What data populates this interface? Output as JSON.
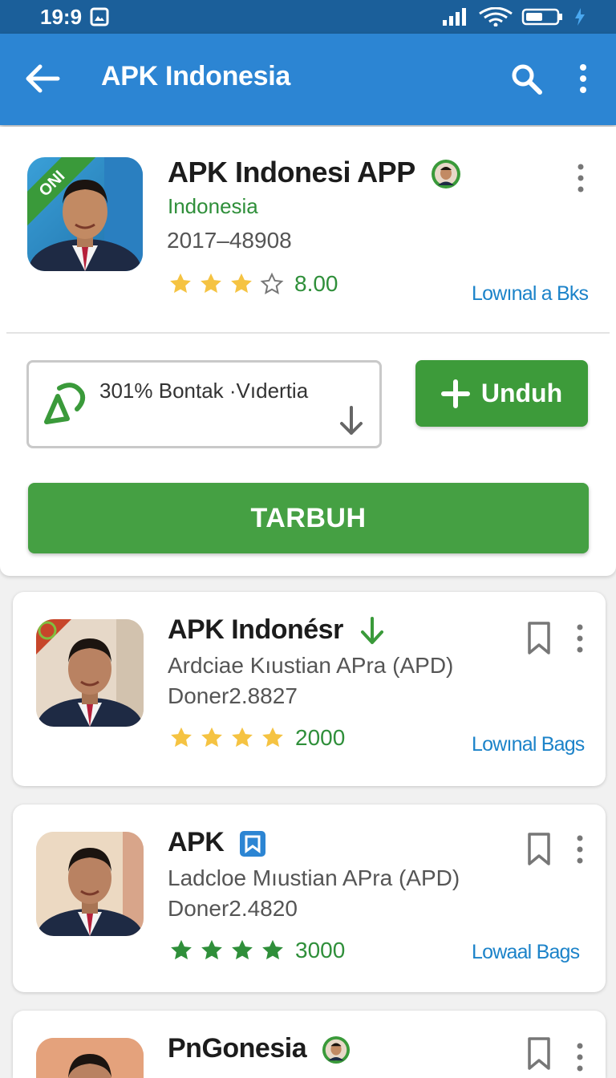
{
  "status_bar": {
    "time": "19:9"
  },
  "app_bar": {
    "title": "APK Indonesia"
  },
  "hero": {
    "icon_ribbon": "ONI",
    "title": "APK Indonesi APP",
    "country": "Indonesia",
    "code": "2017–48908",
    "rating_value": "8.00",
    "stars_filled": 3,
    "stars_total": 4,
    "link": "Lowınal a Bks",
    "select_text": "301% Bontak ·Vıdertia",
    "unduh_label": "Unduh",
    "main_button_label": "TARBUH"
  },
  "list": [
    {
      "title": "APK Indonésr",
      "subtitle": "Ardciae Kıustian APra (APD)",
      "meta": "Doner2.8827",
      "rating_value": "2000",
      "star_color": "#f5c342",
      "link": "Lowınal Bags"
    },
    {
      "title": "APK",
      "subtitle": "Ladcloe Mıustian APra (APD)",
      "meta": "Doner2.4820",
      "rating_value": "3000",
      "star_color": "#2f8f3a",
      "link": "Lowaal Bags"
    },
    {
      "title": "PnGonesia",
      "subtitle": "",
      "meta": "",
      "rating_value": "",
      "star_color": "#f5c342",
      "link": ""
    }
  ],
  "colors": {
    "status_bar": "#1b5f9a",
    "app_bar": "#2c85d3",
    "primary_green": "#3d9b3a",
    "link_blue": "#1c83c9",
    "star_yellow": "#f5c342"
  },
  "icons": [
    "back-arrow-icon",
    "search-icon",
    "more-vert-icon",
    "download-icon",
    "bookmark-icon",
    "plus-icon",
    "verified-avatar-icon"
  ]
}
